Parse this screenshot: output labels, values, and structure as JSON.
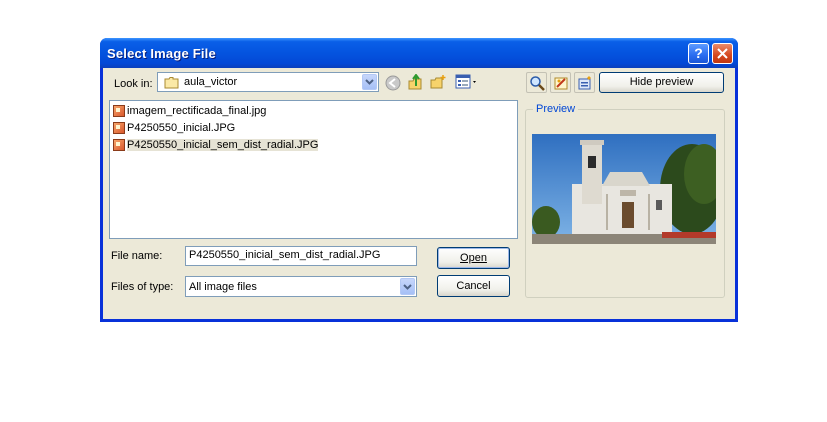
{
  "dialog": {
    "title": "Select Image File",
    "help_glyph": "?",
    "close_glyph": "✕"
  },
  "toolbar": {
    "look_in_label": "Look in:",
    "look_in_value": "aula_victor",
    "hide_preview_label": "Hide preview"
  },
  "files": [
    {
      "name": "imagem_rectificada_final.jpg"
    },
    {
      "name": "P4250550_inicial.JPG"
    },
    {
      "name": "P4250550_inicial_sem_dist_radial.JPG"
    }
  ],
  "form": {
    "file_name_label": "File name:",
    "file_name_value": "P4250550_inicial_sem_dist_radial.JPG",
    "files_of_type_label": "Files of type:",
    "files_of_type_value": "All image files",
    "open_label": "Open",
    "cancel_label": "Cancel"
  },
  "preview": {
    "label": "Preview"
  },
  "colors": {
    "titlebar": "#0454df",
    "dialog_bg": "#ece9d8",
    "preview_label": "#0046d5"
  }
}
